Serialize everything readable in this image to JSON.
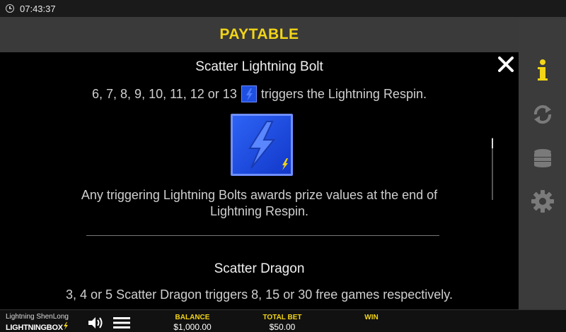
{
  "status": {
    "time": "07:43:37"
  },
  "header": {
    "title": "PAYTABLE"
  },
  "sidebar": {
    "icons": [
      "info-icon",
      "respin-icon",
      "coins-icon",
      "gear-icon"
    ],
    "accent": "#f2d516"
  },
  "content": {
    "scatter_bolt_title": "Scatter Lightning Bolt",
    "trigger_prefix": "6, 7, 8, 9, 10, 11, 12 or 13",
    "trigger_suffix": "triggers the Lightning Respin.",
    "bolt_desc": "Any triggering Lightning Bolts awards prize values at the end of Lightning Respin.",
    "scatter_dragon_title": "Scatter Dragon",
    "dragon_desc": "3, 4 or 5 Scatter Dragon triggers 8, 15 or 30 free games respectively."
  },
  "footer": {
    "game_name": "Lightning ShenLong",
    "brand": "LIGHTNINGBOX",
    "balance_label": "BALANCE",
    "balance_value": "$1,000.00",
    "total_bet_label": "TOTAL BET",
    "total_bet_value": "$50.00",
    "win_label": "WIN"
  },
  "colors": {
    "symbol_blue": "#1f4fe0",
    "header_bg": "#3a3a3a",
    "side_bg": "#3b3b3b"
  }
}
